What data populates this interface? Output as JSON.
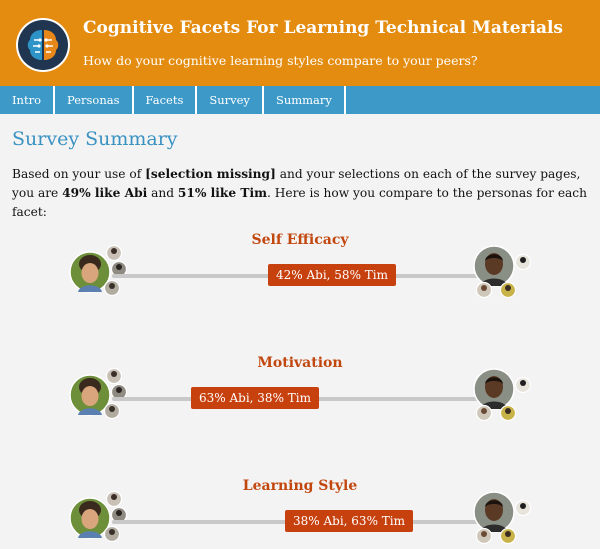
{
  "header": {
    "title": "Cognitive Facets For Learning Technical Materials",
    "subtitle": "How do your cognitive learning styles compare to your peers?"
  },
  "nav": {
    "items": [
      {
        "label": "Intro"
      },
      {
        "label": "Personas"
      },
      {
        "label": "Facets"
      },
      {
        "label": "Survey"
      },
      {
        "label": "Summary"
      }
    ]
  },
  "main": {
    "title": "Survey Summary",
    "intro": {
      "p1": "Based on your use of ",
      "selection": "[selection missing]",
      "p2": " and your selections on each of the survey pages, you are ",
      "abi_pct": "49% like Abi",
      "p3": " and ",
      "tim_pct": "51% like Tim",
      "p4": ". Here is how you compare to the personas for each facet:"
    },
    "facets": [
      {
        "title": "Self Efficacy",
        "label": "42% Abi, 58% Tim",
        "abi": 42,
        "tim": 58
      },
      {
        "title": "Motivation",
        "label": "63% Abi, 38% Tim",
        "abi": 63,
        "tim": 38
      },
      {
        "title": "Learning Style",
        "label": "38% Abi, 63% Tim",
        "abi": 38,
        "tim": 63
      }
    ]
  },
  "colors": {
    "header_bg": "#e38c10",
    "nav_bg": "#3c99c8",
    "title_blue": "#3a92c2",
    "facet_orange": "#c7410e"
  }
}
